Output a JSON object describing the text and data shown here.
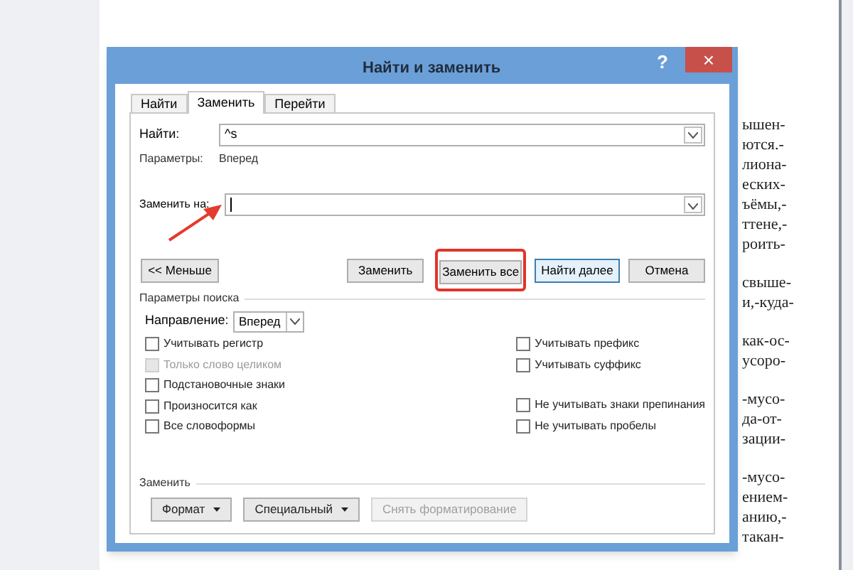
{
  "document": {
    "paragraphs": [
      {
        "lines": [
          "ышен-",
          "ются.-",
          "лиона-",
          "еских-",
          "ъёмы,-",
          "ттене,-",
          "роить-"
        ]
      },
      {
        "lines": [
          "свыше-",
          "и,-куда-"
        ]
      },
      {
        "lines": [
          "как-ос-",
          "усоро-"
        ]
      },
      {
        "lines": [
          "-мусо-",
          "да-от-",
          "зации-"
        ]
      },
      {
        "lines": [
          "-мусо-",
          "ением-",
          "анию,-",
          "такан-"
        ]
      }
    ]
  },
  "window": {
    "title": "Найти и заменить",
    "help": "?",
    "close": "×"
  },
  "tabs": [
    {
      "label": "Найти",
      "selected": false
    },
    {
      "label": "Заменить",
      "selected": true
    },
    {
      "label": "Перейти",
      "selected": false
    }
  ],
  "find": {
    "label": "Найти:",
    "value": "^s",
    "options_label": "Параметры:",
    "options_value": "Вперед"
  },
  "replace": {
    "label": "Заменить на:"
  },
  "buttons": [
    {
      "label": "<< Меньше",
      "highlighted": false,
      "default": false
    },
    {
      "label": "Заменить",
      "highlighted": false,
      "default": false
    },
    {
      "label": "Заменить все",
      "highlighted": true,
      "default": false
    },
    {
      "label": "Найти далее",
      "highlighted": false,
      "default": true
    },
    {
      "label": "Отмена",
      "highlighted": false,
      "default": false
    }
  ],
  "search_options": {
    "title": "Параметры поиска",
    "direction_label": "Направление:",
    "direction_value": "Вперед",
    "left": [
      {
        "items": [
          {
            "label": "Учитывать регистр",
            "checked": false,
            "disabled": false
          },
          {
            "label": "Только слово целиком",
            "checked": false,
            "disabled": true
          },
          {
            "label": "Подстановочные знаки",
            "checked": false,
            "disabled": false
          },
          {
            "label": "Произносится как",
            "checked": false,
            "disabled": false
          },
          {
            "label": "Все словоформы",
            "checked": false,
            "disabled": false
          }
        ]
      }
    ],
    "right": [
      {
        "items": [
          {
            "label": "Учитывать префикс",
            "checked": false,
            "disabled": false
          },
          {
            "label": "Учитывать суффикс",
            "checked": false,
            "disabled": false
          }
        ]
      },
      {
        "items": [
          {
            "label": "Не учитывать знаки препинания",
            "checked": false,
            "disabled": false
          },
          {
            "label": "Не учитывать пробелы",
            "checked": false,
            "disabled": false
          }
        ]
      }
    ]
  },
  "replace_group": {
    "title": "Заменить",
    "buttons": [
      {
        "label": "Формат",
        "dropdown": true,
        "disabled": false
      },
      {
        "label": "Специальный",
        "dropdown": true,
        "disabled": false
      },
      {
        "label": "Снять форматирование",
        "dropdown": false,
        "disabled": true
      }
    ]
  }
}
